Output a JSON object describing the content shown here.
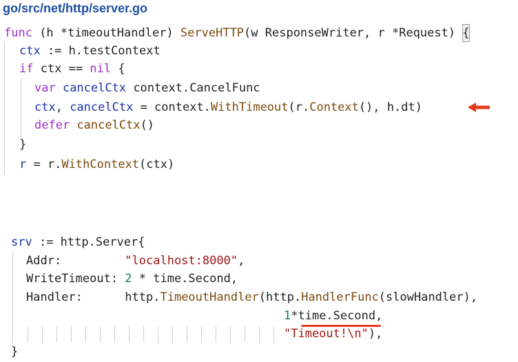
{
  "title": "go/src/net/http/server.go",
  "snippet1": {
    "l1": {
      "func": "func",
      "open": " (h ",
      "ptr": "*timeoutHandler",
      "close": ") ",
      "fn": "ServeHTTP",
      "p1": "(w ResponseWriter, r ",
      "p2": "*Request) ",
      "brace": "{"
    },
    "l2": {
      "ctx": "ctx",
      "assign": " := h.testContext"
    },
    "l3": {
      "if": "if",
      "ctx": " ctx ",
      "eq": "== ",
      "nil": "nil",
      "brace": " {"
    },
    "l4": {
      "var": "var",
      "cancel": " cancelCtx",
      "type": " context.CancelFunc"
    },
    "l5": {
      "ctx": "ctx",
      "comma": ", ",
      "cancel": "cancelCtx",
      "eq": " = context.",
      "fn": "WithTimeout",
      "arg1": "(r.",
      "fn2": "Context",
      "arg2": "(), h.dt)"
    },
    "l6": {
      "defer": "defer",
      "space": " ",
      "fn": "cancelCtx",
      "paren": "()"
    },
    "l7": {
      "brace": "}"
    },
    "l8": {
      "r": "r",
      "eq": " = r.",
      "fn": "WithContext",
      "arg": "(ctx)"
    }
  },
  "snippet2": {
    "l1": {
      "srv": "srv",
      "rest": " := http.Server{"
    },
    "l2": {
      "key": "Addr:         ",
      "val": "\"localhost:8000\"",
      "comma": ","
    },
    "l3": {
      "key": "WriteTimeout: ",
      "num": "2",
      "rest": " * time.Second,"
    },
    "l4": {
      "key": "Handler:      ",
      "pkg": "http.",
      "fn": "TimeoutHandler",
      "mid": "(http.",
      "fn2": "HandlerFunc",
      "end": "(slowHandler),"
    },
    "l5": {
      "num": "1",
      "rest": "*time.Second,"
    },
    "l6": {
      "str": "\"Timeout!\\n\"",
      "end": "),"
    },
    "l7": {
      "brace": "}"
    }
  },
  "colors": {
    "title": "#1d4fa0",
    "keyword": "#9b30c9",
    "identifier": "#1a33a8",
    "function": "#7a4a0e",
    "string": "#a31515",
    "number": "#0f7b4b",
    "annotation": "#e53a1e"
  },
  "annotations": {
    "arrow": "arrow-left-icon",
    "underline": "underline-mark"
  }
}
